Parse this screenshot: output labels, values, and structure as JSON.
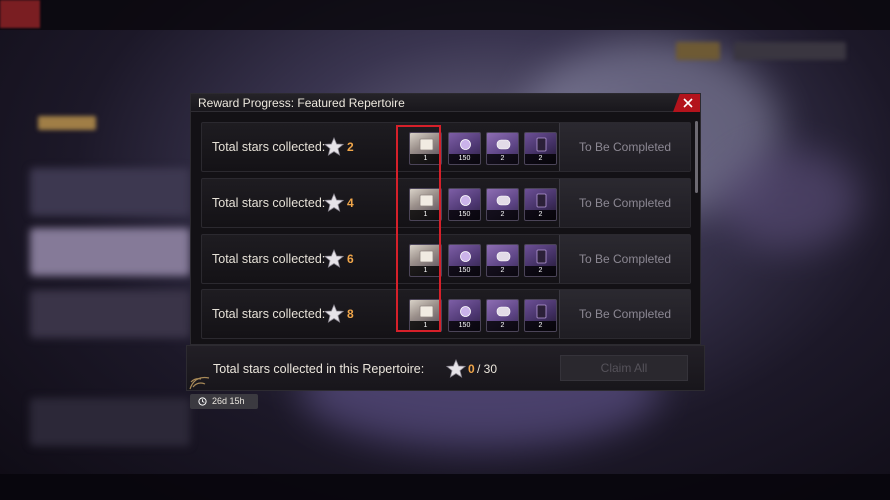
{
  "dialog": {
    "title": "Reward Progress: Featured Repertoire",
    "close_icon": "close-icon"
  },
  "rows": [
    {
      "label": "Total stars collected:",
      "stars": "2",
      "items": [
        {
          "kind": "ticket",
          "count": "1"
        },
        {
          "kind": "gem",
          "count": "150"
        },
        {
          "kind": "scroll",
          "count": "2"
        },
        {
          "kind": "card",
          "count": "2"
        }
      ],
      "status": "To Be Completed"
    },
    {
      "label": "Total stars collected:",
      "stars": "4",
      "items": [
        {
          "kind": "ticket",
          "count": "1"
        },
        {
          "kind": "gem",
          "count": "150"
        },
        {
          "kind": "scroll",
          "count": "2"
        },
        {
          "kind": "card",
          "count": "2"
        }
      ],
      "status": "To Be Completed"
    },
    {
      "label": "Total stars collected:",
      "stars": "6",
      "items": [
        {
          "kind": "ticket",
          "count": "1"
        },
        {
          "kind": "gem",
          "count": "150"
        },
        {
          "kind": "scroll",
          "count": "2"
        },
        {
          "kind": "card",
          "count": "2"
        }
      ],
      "status": "To Be Completed"
    },
    {
      "label": "Total stars collected:",
      "stars": "8",
      "items": [
        {
          "kind": "ticket",
          "count": "1"
        },
        {
          "kind": "gem",
          "count": "150"
        },
        {
          "kind": "scroll",
          "count": "2"
        },
        {
          "kind": "card",
          "count": "2"
        }
      ],
      "status": "To Be Completed"
    }
  ],
  "footer": {
    "label": "Total stars collected in this Repertoire:",
    "collected": "0",
    "total": "/ 30",
    "claim_label": "Claim All"
  },
  "timer": {
    "label": "26d 15h"
  },
  "colors": {
    "accent_orange": "#f0a64a",
    "close_red": "#b3131c",
    "highlight_red": "#d6202a"
  }
}
